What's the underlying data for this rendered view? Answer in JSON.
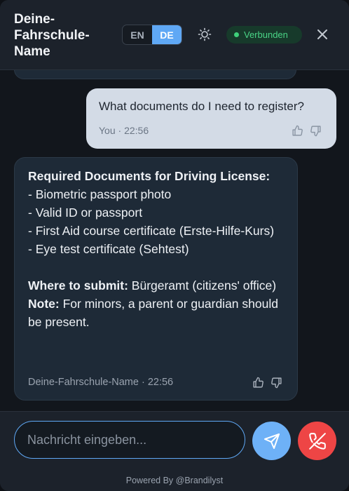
{
  "header": {
    "brand_line1": "Deine-",
    "brand_line2": "Fahrschule-",
    "brand_line3": "Name",
    "lang_en": "EN",
    "lang_de": "DE",
    "active_lang": "DE",
    "status": "Verbunden",
    "theme_icon": "sun-icon",
    "close_icon": "close-icon"
  },
  "messages": {
    "user": {
      "text": "What documents do I need to register?",
      "meta": "You · 22:56"
    },
    "bot": {
      "heading": "Required Documents for Driving License:",
      "items": [
        "- Biometric passport photo",
        "- Valid ID or passport",
        "- First Aid course certificate (Erste-Hilfe-Kurs)",
        "- Eye test certificate (Sehtest)"
      ],
      "where_label": "Where to submit:",
      "where_text": " Bürgeramt (citizens' office)",
      "note_label": "Note:",
      "note_text": " For minors, a parent or guardian should be present.",
      "meta": "Deine-Fahrschule-Name · 22:56"
    }
  },
  "composer": {
    "placeholder": "Nachricht eingeben...",
    "value": ""
  },
  "footer": {
    "text": "Powered By @Brandilyst"
  },
  "colors": {
    "accent": "#5fa8f5",
    "status_green": "#4ad486",
    "end_call_red": "#ee4545"
  }
}
